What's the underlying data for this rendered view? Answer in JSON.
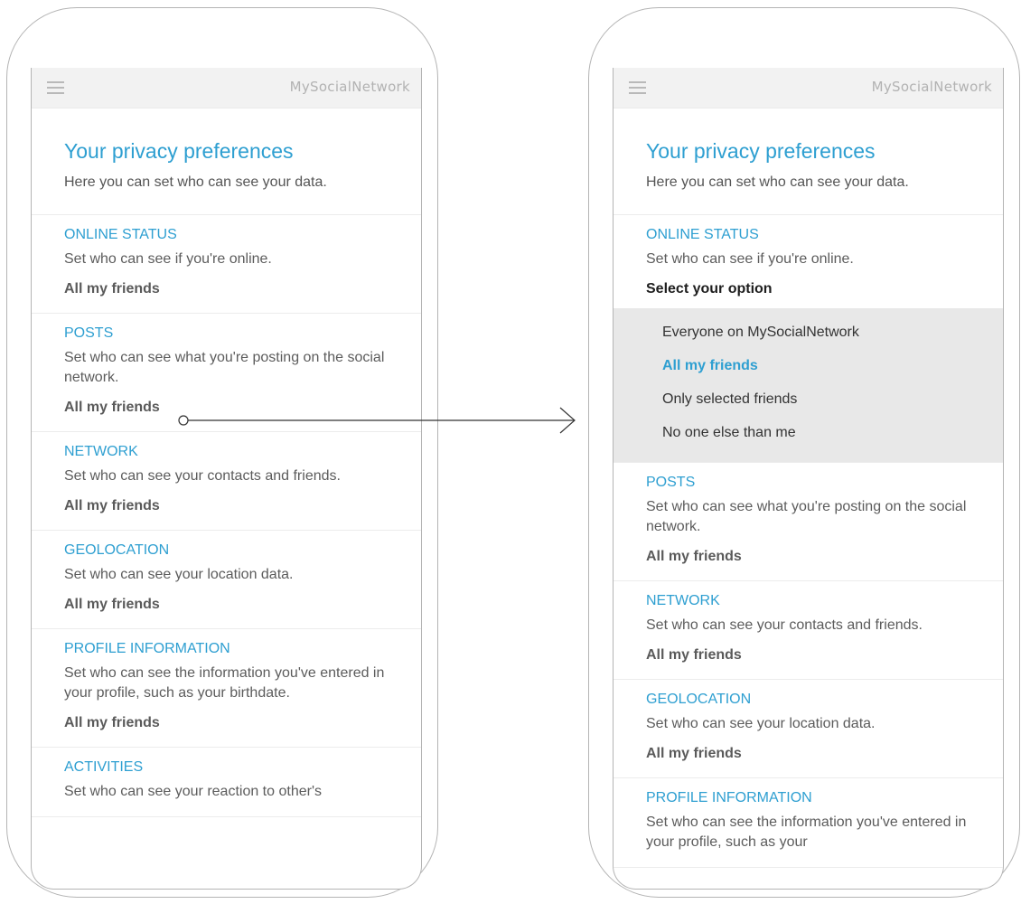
{
  "app": {
    "brand": "MySocialNetwork"
  },
  "page": {
    "title": "Your privacy preferences",
    "subtitle": "Here you can set who can see your data."
  },
  "left_screen": {
    "sections": [
      {
        "title": "ONLINE STATUS",
        "description": "Set who can see if you're online.",
        "value": "All my friends"
      },
      {
        "title": "POSTS",
        "description": "Set who can see what you're posting on the social network.",
        "value": "All my friends"
      },
      {
        "title": "NETWORK",
        "description": "Set who can see your contacts and friends.",
        "value": "All my friends"
      },
      {
        "title": "GEOLOCATION",
        "description": "Set who can see your location data.",
        "value": "All my friends"
      },
      {
        "title": "PROFILE INFORMATION",
        "description": "Set who can see the information you've entered in your profile, such as your birthdate.",
        "value": "All my friends"
      },
      {
        "title": "ACTIVITIES",
        "description": "Set who can see your reaction to other's"
      }
    ]
  },
  "right_screen": {
    "expanded_section": {
      "title": "ONLINE STATUS",
      "description": "Set who can see if you're online.",
      "select_label": "Select your option",
      "options": [
        "Everyone on MySocialNetwork",
        "All my friends",
        "Only selected friends",
        "No one else than me"
      ],
      "selected_option": "All my friends"
    },
    "sections": [
      {
        "title": "POSTS",
        "description": "Set who can see what you're posting on the social network.",
        "value": "All my friends"
      },
      {
        "title": "NETWORK",
        "description": "Set who can see your contacts and friends.",
        "value": "All my friends"
      },
      {
        "title": "GEOLOCATION",
        "description": "Set who can see your location data.",
        "value": "All my friends"
      },
      {
        "title": "PROFILE INFORMATION",
        "description": "Set who can see the information you've entered in your profile, such as your"
      }
    ]
  },
  "icons": {
    "menu": "hamburger-menu-icon"
  },
  "colors": {
    "accent": "#2e9fd1",
    "appbar": "#f2f2f2",
    "dropdown_bg": "#e8e8e8",
    "text": "#5c5c5c"
  }
}
